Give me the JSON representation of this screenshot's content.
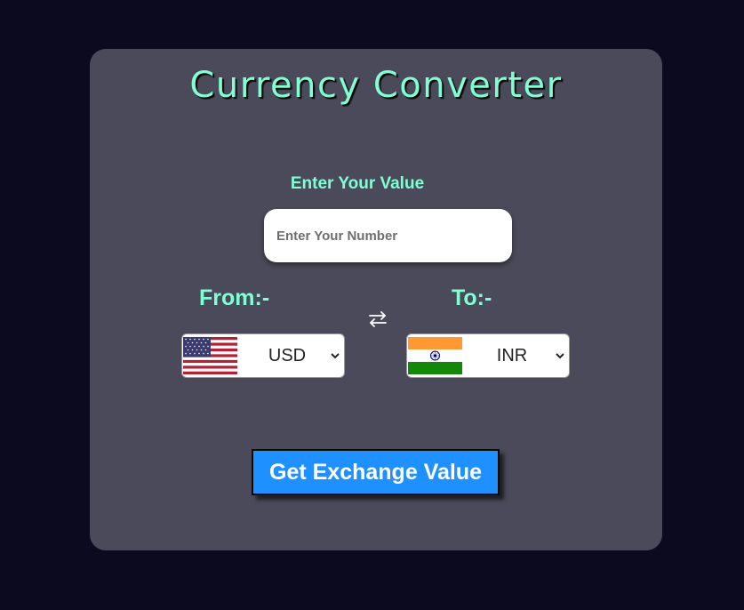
{
  "app": {
    "title": "Currency Converter"
  },
  "amount": {
    "label": "Enter Your Value",
    "placeholder": "Enter Your Number",
    "value": ""
  },
  "from": {
    "label": "From:-",
    "currency": "USD",
    "flag_icon": "us-flag-icon"
  },
  "to": {
    "label": "To:-",
    "currency": "INR",
    "flag_icon": "india-flag-icon"
  },
  "swap_icon": "swap-arrows-icon",
  "action": {
    "button_label": "Get Exchange Value"
  },
  "colors": {
    "page_background": "#0b0a1e",
    "card_background": "#4b4a5a",
    "accent_text": "#7fffd4",
    "button_background": "#1e90ff"
  }
}
